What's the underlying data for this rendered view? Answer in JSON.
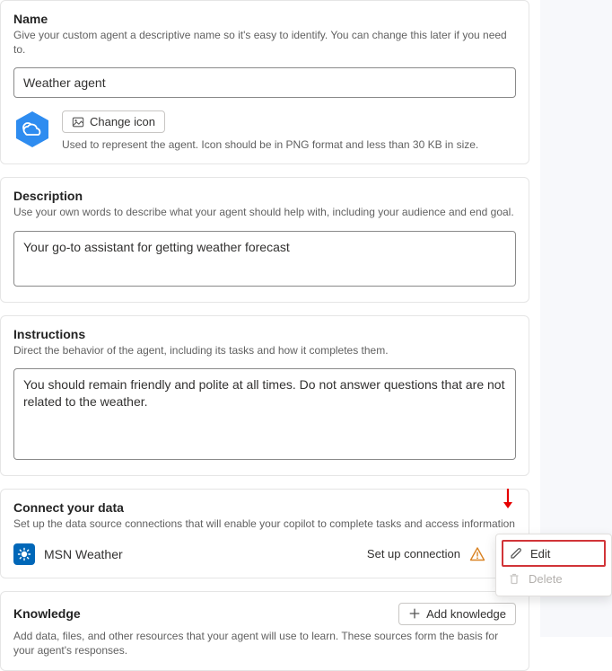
{
  "name": {
    "title": "Name",
    "help": "Give your custom agent a descriptive name so it's easy to identify. You can change this later if you need to.",
    "value": "Weather agent",
    "change_icon": "Change icon",
    "icon_help": "Used to represent the agent. Icon should be in PNG format and less than 30 KB in size."
  },
  "description": {
    "title": "Description",
    "help": "Use your own words to describe what your agent should help with, including your audience and end goal.",
    "value": "Your go-to assistant for getting weather forecast"
  },
  "instructions": {
    "title": "Instructions",
    "help": "Direct the behavior of the agent, including its tasks and how it completes them.",
    "value": "You should remain friendly and polite at all times. Do not answer questions that are not related to the weather."
  },
  "connect": {
    "title": "Connect your data",
    "help": "Set up the data source connections that will enable your copilot to complete tasks and access information",
    "connector": {
      "name": "MSN Weather",
      "setup": "Set up connection"
    }
  },
  "knowledge": {
    "title": "Knowledge",
    "add_btn": "Add knowledge",
    "help": "Add data, files, and other resources that your agent will use to learn. These sources form the basis for your agent's responses."
  },
  "menu": {
    "edit": "Edit",
    "delete": "Delete"
  }
}
